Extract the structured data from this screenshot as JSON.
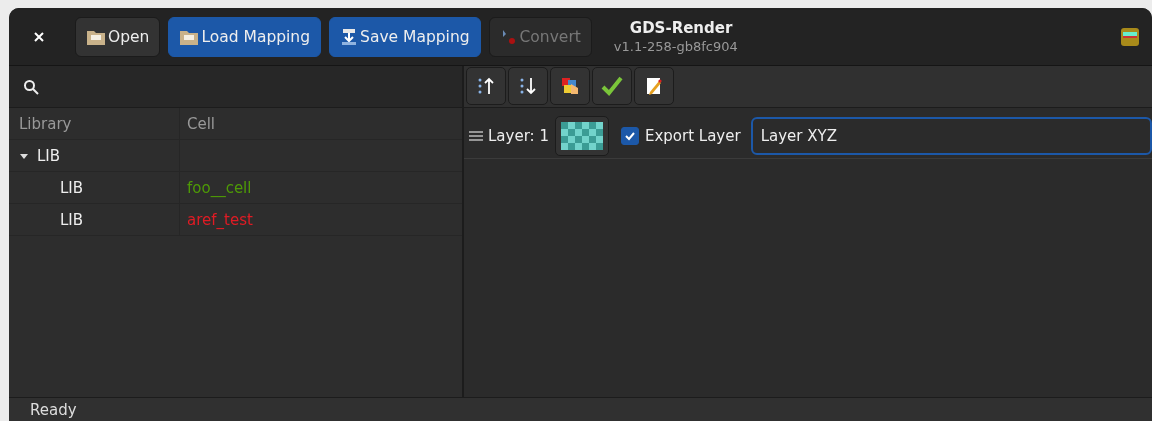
{
  "header": {
    "title": "GDS-Render",
    "subtitle": "v1.1-258-gb8fc904",
    "buttons": [
      {
        "label": "Open",
        "kind": "normal",
        "disabled": false
      },
      {
        "label": "Load Mapping",
        "kind": "suggested",
        "disabled": false
      },
      {
        "label": "Save Mapping",
        "kind": "suggested",
        "disabled": false
      },
      {
        "label": "Convert",
        "kind": "normal",
        "disabled": true
      }
    ]
  },
  "cell_tree": {
    "columns": [
      "Library",
      "Cell"
    ],
    "rows": [
      {
        "library": "LIB",
        "cell": "",
        "expanded": true,
        "children": [
          {
            "library": "LIB",
            "cell": "foo__cell",
            "color": "#4e9a06"
          },
          {
            "library": "LIB",
            "cell": "aref_test",
            "color": "#e01b24"
          }
        ]
      }
    ]
  },
  "layers": [
    {
      "label": "Layer: 1",
      "export": true,
      "export_label": "Export Layer",
      "name": "Layer XYZ"
    }
  ],
  "status_bar": "Ready"
}
